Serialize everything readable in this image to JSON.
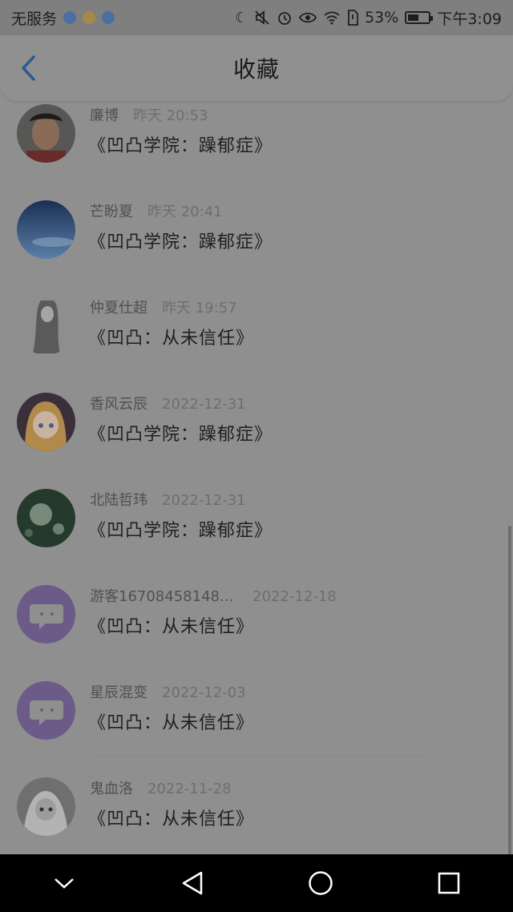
{
  "status_bar": {
    "carrier": "无服务",
    "battery": "53%",
    "battery_level": 0.53,
    "time": "下午3:09",
    "indicator_colors": [
      "#4a6fa0",
      "#a58a4a",
      "#4a6fa0"
    ],
    "icons": [
      "moon-icon",
      "mute-icon",
      "alarm-icon",
      "eye-icon",
      "wifi-icon",
      "sim-icon"
    ]
  },
  "header": {
    "title": "收藏",
    "back_icon": "chevron-left-icon",
    "accent": "#2a5d8f"
  },
  "items": [
    {
      "username": "廉博",
      "time": "昨天 20:53",
      "title": "《凹凸学院：躁郁症》",
      "avatar": "photo-person"
    },
    {
      "username": "芒盼夏",
      "time": "昨天 20:41",
      "title": "《凹凸学院：躁郁症》",
      "avatar": "photo-sky"
    },
    {
      "username": "仲夏仕超",
      "time": "昨天 19:57",
      "title": "《凹凸：从未信任》",
      "avatar": "photo-sketch"
    },
    {
      "username": "香风云辰",
      "time": "2022-12-31",
      "title": "《凹凸学院：躁郁症》",
      "avatar": "photo-anime"
    },
    {
      "username": "北陆哲玮",
      "time": "2022-12-31",
      "title": "《凹凸学院：躁郁症》",
      "avatar": "photo-dandelion"
    },
    {
      "username": "游客16708458148...",
      "time": "2022-12-18",
      "title": "《凹凸：从未信任》",
      "avatar": "default-chat"
    },
    {
      "username": "星辰混变",
      "time": "2022-12-03",
      "title": "《凹凸：从未信任》",
      "avatar": "default-chat"
    },
    {
      "username": "鬼血洛",
      "time": "2022-11-28",
      "title": "《凹凸：从未信任》",
      "avatar": "photo-gray"
    }
  ],
  "nav": {
    "icons": [
      "chevron-down-icon",
      "back-triangle-icon",
      "home-circle-icon",
      "recents-square-icon"
    ]
  }
}
